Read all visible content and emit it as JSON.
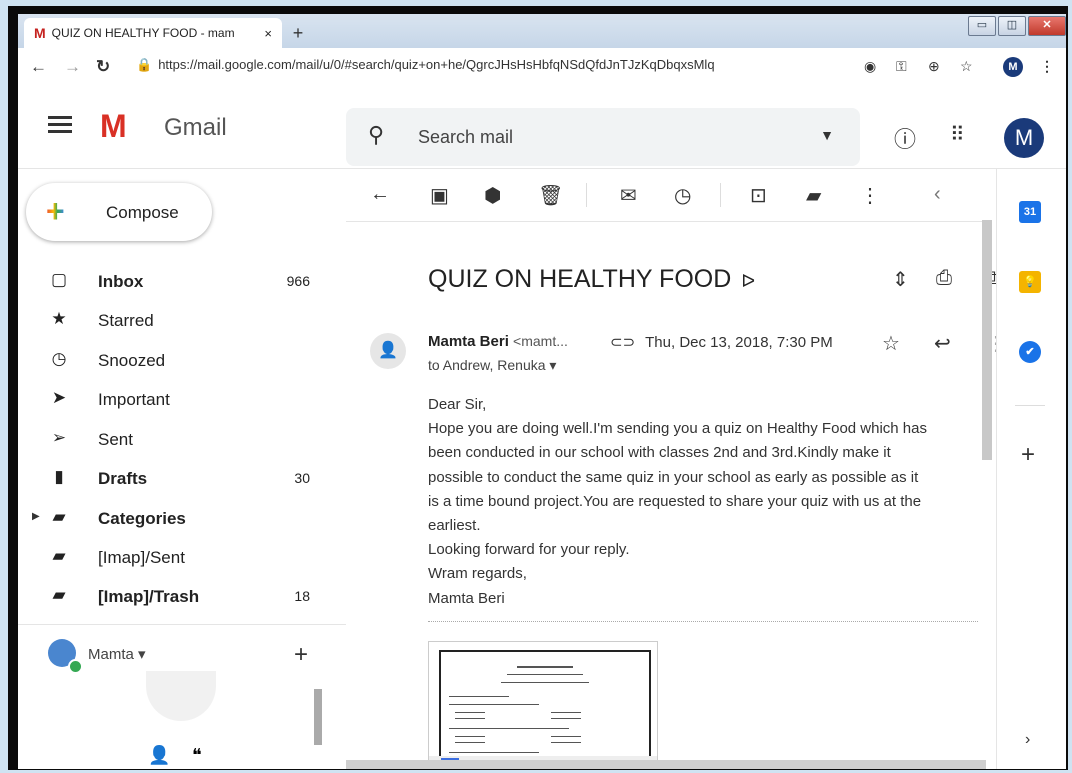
{
  "browser": {
    "tab_title": "QUIZ ON HEALTHY FOOD - mam",
    "tab_close": "×",
    "new_tab": "+",
    "url": "https://mail.google.com/mail/u/0/#search/quiz+on+he/QgrcJHsHsHbfqNSdQfdJnTJzKqDbqxsMlq",
    "profile_initial": "M"
  },
  "header": {
    "app_name": "Gmail",
    "search_placeholder": "Search mail",
    "avatar_initial": "M"
  },
  "sidebar": {
    "compose_label": "Compose",
    "items": [
      {
        "label": "Inbox",
        "count": "966",
        "bold": true
      },
      {
        "label": "Starred",
        "count": ""
      },
      {
        "label": "Snoozed",
        "count": ""
      },
      {
        "label": "Important",
        "count": ""
      },
      {
        "label": "Sent",
        "count": ""
      },
      {
        "label": "Drafts",
        "count": "30",
        "bold": true
      },
      {
        "label": "Categories",
        "count": "",
        "bold": true
      },
      {
        "label": "[Imap]/Sent",
        "count": ""
      },
      {
        "label": "[Imap]/Trash",
        "count": "18",
        "bold": true
      }
    ],
    "hangouts_user": "Mamta"
  },
  "message": {
    "subject": "QUIZ ON HEALTHY FOOD",
    "sender_name": "Mamta Beri",
    "sender_email": "<mamt...",
    "date": "Thu, Dec 13, 2018, 7:30 PM",
    "recipients": "to Andrew, Renuka",
    "body_lines": [
      "Dear Sir,",
      "Hope you are doing well.I'm sending you a quiz on Healthy Food which has",
      "been conducted in our school with classes 2nd and 3rd.Kindly make it",
      "possible to conduct the same quiz in your school  as early as possible as it",
      "is a time bound project.You are requested to share your quiz with us at the",
      "earliest.",
      "Looking forward for your reply.",
      "Wram regards,",
      "Mamta Beri"
    ]
  },
  "right_panel": {
    "calendar_label": "31"
  },
  "colors": {
    "gmail_red": "#d93025",
    "avatar_blue": "#1a3a7a",
    "keep_yellow": "#f4b400",
    "tasks_blue": "#1a73e8"
  }
}
